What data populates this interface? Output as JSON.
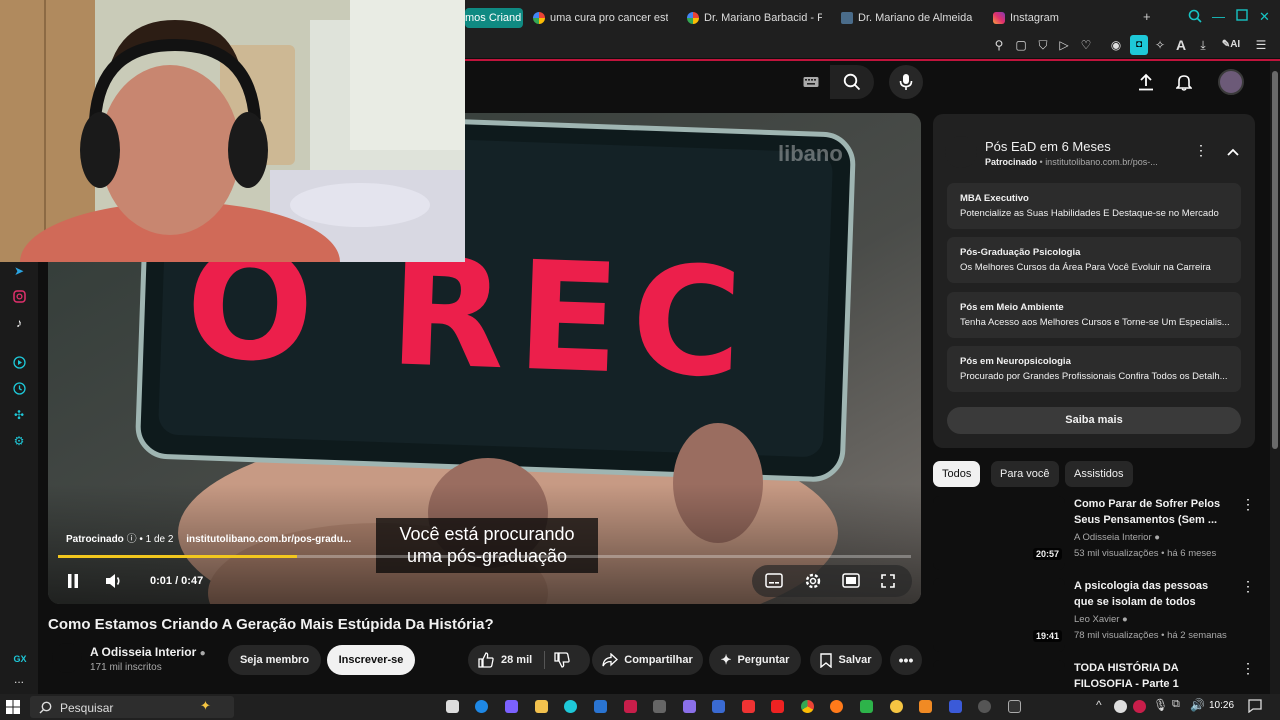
{
  "browser": {
    "tabs": [
      {
        "label": "mos Criand",
        "active": true
      },
      {
        "label": "uma cura pro cancer esta",
        "active": false
      },
      {
        "label": "Dr. Mariano Barbacid - Pe",
        "active": false
      },
      {
        "label": "Dr. Mariano de Almeida M",
        "active": false
      },
      {
        "label": "Instagram",
        "active": false
      }
    ],
    "new_tab": "+",
    "ai_label": "AI",
    "accent_color": "#c0143c"
  },
  "sidebar": {
    "items": [
      "telegram-icon",
      "instagram-icon",
      "tiktok-icon",
      "player-icon",
      "history-icon",
      "extensions-icon",
      "settings-icon"
    ],
    "gx_label": "GX",
    "more": "..."
  },
  "player": {
    "screen_text": "O REC",
    "watermark": "libano",
    "ad_label": "Patrocinado",
    "ad_count": "1 de 2",
    "ad_url": "institutolibano.com.br/pos-gradu...",
    "caption_lines": [
      "Você está procurando",
      "uma pós-graduação"
    ],
    "time": "0:01 / 0:47",
    "progress_pct": 28
  },
  "video": {
    "title": "Como Estamos Criando A Geração Mais Estúpida Da História?",
    "channel": "A Odisseia Interior",
    "subscribers": "171 mil inscritos",
    "member_label": "Seja membro",
    "subscribe_label": "Inscrever-se",
    "likes": "28 mil",
    "share_label": "Compartilhar",
    "ask_label": "Perguntar",
    "save_label": "Salvar"
  },
  "ad_panel": {
    "title": "Pós EaD em 6 Meses",
    "sponsored": "Patrocinado",
    "domain": "institutolibano.com.br/pos-...",
    "links": [
      {
        "title": "MBA Executivo",
        "desc": "Potencialize as Suas Habilidades E Destaque-se no Mercado"
      },
      {
        "title": "Pós-Graduação Psicologia",
        "desc": "Os Melhores Cursos da Área Para Você Evoluir na Carreira"
      },
      {
        "title": "Pós em Meio Ambiente",
        "desc": "Tenha Acesso aos Melhores Cursos e Torne-se Um Especialis..."
      },
      {
        "title": "Pós em Neuropsicologia",
        "desc": "Procurado por Grandes Profissionais Confira Todos os Detalh..."
      }
    ],
    "cta": "Saiba mais"
  },
  "chips": [
    "Todos",
    "Para você",
    "Assistidos"
  ],
  "recommendations": [
    {
      "title": "Como Parar de Sofrer Pelos Seus Pensamentos (Sem ...",
      "channel": "A Odisseia Interior",
      "meta": "53 mil visualizações • há 6 meses",
      "duration": "20:57"
    },
    {
      "title": "A psicologia das pessoas que se isolam de todos",
      "channel": "Leo Xavier",
      "meta": "78 mil visualizações • há 2 semanas",
      "duration": "19:41"
    },
    {
      "title": "TODA HISTÓRIA DA FILOSOFIA - Parte 1",
      "channel": "",
      "meta": "",
      "duration": ""
    }
  ],
  "taskbar": {
    "search_label": "Pesquisar",
    "time": "10:26"
  }
}
